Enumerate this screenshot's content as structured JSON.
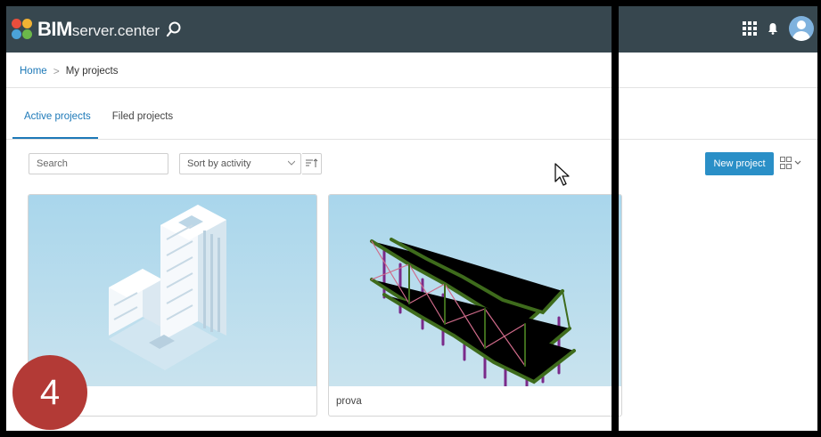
{
  "header": {
    "brand_bold": "BIM",
    "brand_rest": "server.center",
    "search_icon": "search-icon",
    "apps_icon": "grid-apps-icon",
    "bell_icon": "bell-icon",
    "avatar_icon": "user-avatar-icon"
  },
  "breadcrumb": {
    "home": "Home",
    "separator": ">",
    "current": "My projects"
  },
  "tabs": [
    {
      "label": "Active projects",
      "active": true
    },
    {
      "label": "Filed projects",
      "active": false
    }
  ],
  "toolbar": {
    "search_placeholder": "Search",
    "sort_label": "Sort by activity",
    "new_project_label": "New project"
  },
  "projects": [
    {
      "name": ""
    },
    {
      "name": "prova"
    }
  ],
  "badge": {
    "number": "4"
  },
  "colors": {
    "topbar": "#37474f",
    "accent": "#1d79b8",
    "button": "#2a8fc7",
    "badge": "#b33a36"
  }
}
